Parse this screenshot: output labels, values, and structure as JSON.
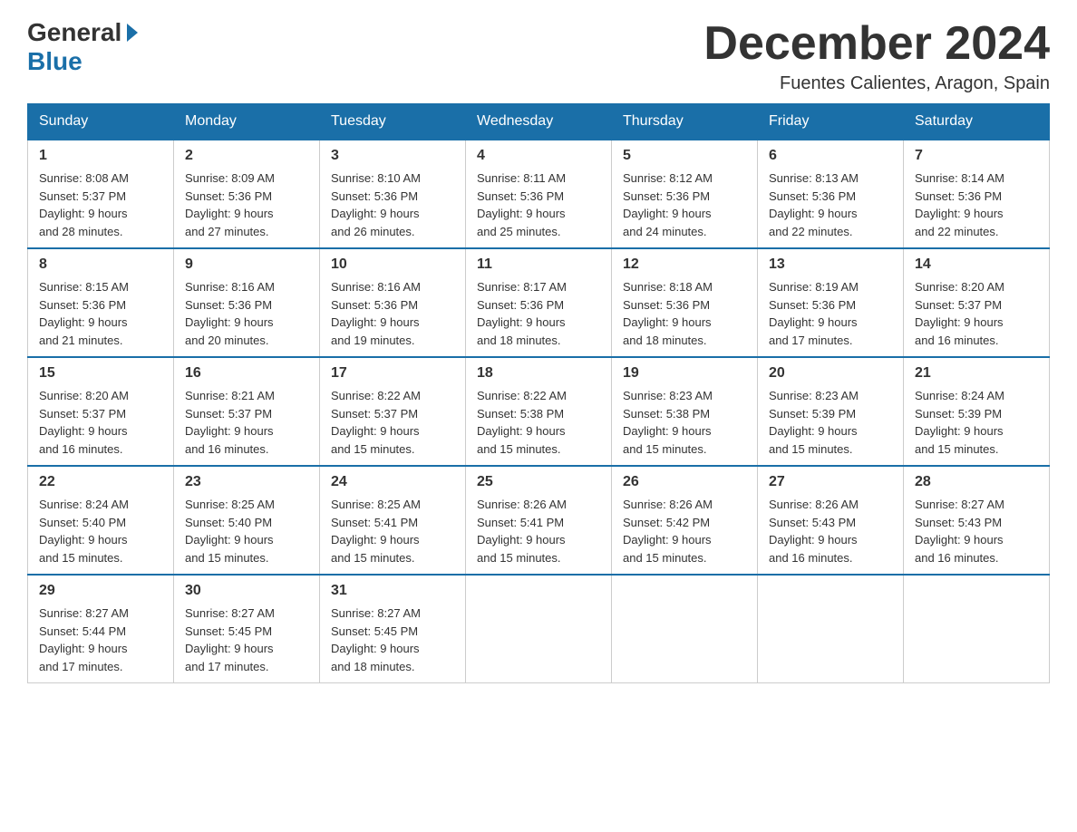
{
  "header": {
    "logo_general": "General",
    "logo_blue": "Blue",
    "month_title": "December 2024",
    "location": "Fuentes Calientes, Aragon, Spain"
  },
  "days_of_week": [
    "Sunday",
    "Monday",
    "Tuesday",
    "Wednesday",
    "Thursday",
    "Friday",
    "Saturday"
  ],
  "weeks": [
    [
      {
        "day": "1",
        "sunrise": "8:08 AM",
        "sunset": "5:37 PM",
        "daylight": "9 hours and 28 minutes."
      },
      {
        "day": "2",
        "sunrise": "8:09 AM",
        "sunset": "5:36 PM",
        "daylight": "9 hours and 27 minutes."
      },
      {
        "day": "3",
        "sunrise": "8:10 AM",
        "sunset": "5:36 PM",
        "daylight": "9 hours and 26 minutes."
      },
      {
        "day": "4",
        "sunrise": "8:11 AM",
        "sunset": "5:36 PM",
        "daylight": "9 hours and 25 minutes."
      },
      {
        "day": "5",
        "sunrise": "8:12 AM",
        "sunset": "5:36 PM",
        "daylight": "9 hours and 24 minutes."
      },
      {
        "day": "6",
        "sunrise": "8:13 AM",
        "sunset": "5:36 PM",
        "daylight": "9 hours and 22 minutes."
      },
      {
        "day": "7",
        "sunrise": "8:14 AM",
        "sunset": "5:36 PM",
        "daylight": "9 hours and 22 minutes."
      }
    ],
    [
      {
        "day": "8",
        "sunrise": "8:15 AM",
        "sunset": "5:36 PM",
        "daylight": "9 hours and 21 minutes."
      },
      {
        "day": "9",
        "sunrise": "8:16 AM",
        "sunset": "5:36 PM",
        "daylight": "9 hours and 20 minutes."
      },
      {
        "day": "10",
        "sunrise": "8:16 AM",
        "sunset": "5:36 PM",
        "daylight": "9 hours and 19 minutes."
      },
      {
        "day": "11",
        "sunrise": "8:17 AM",
        "sunset": "5:36 PM",
        "daylight": "9 hours and 18 minutes."
      },
      {
        "day": "12",
        "sunrise": "8:18 AM",
        "sunset": "5:36 PM",
        "daylight": "9 hours and 18 minutes."
      },
      {
        "day": "13",
        "sunrise": "8:19 AM",
        "sunset": "5:36 PM",
        "daylight": "9 hours and 17 minutes."
      },
      {
        "day": "14",
        "sunrise": "8:20 AM",
        "sunset": "5:37 PM",
        "daylight": "9 hours and 16 minutes."
      }
    ],
    [
      {
        "day": "15",
        "sunrise": "8:20 AM",
        "sunset": "5:37 PM",
        "daylight": "9 hours and 16 minutes."
      },
      {
        "day": "16",
        "sunrise": "8:21 AM",
        "sunset": "5:37 PM",
        "daylight": "9 hours and 16 minutes."
      },
      {
        "day": "17",
        "sunrise": "8:22 AM",
        "sunset": "5:37 PM",
        "daylight": "9 hours and 15 minutes."
      },
      {
        "day": "18",
        "sunrise": "8:22 AM",
        "sunset": "5:38 PM",
        "daylight": "9 hours and 15 minutes."
      },
      {
        "day": "19",
        "sunrise": "8:23 AM",
        "sunset": "5:38 PM",
        "daylight": "9 hours and 15 minutes."
      },
      {
        "day": "20",
        "sunrise": "8:23 AM",
        "sunset": "5:39 PM",
        "daylight": "9 hours and 15 minutes."
      },
      {
        "day": "21",
        "sunrise": "8:24 AM",
        "sunset": "5:39 PM",
        "daylight": "9 hours and 15 minutes."
      }
    ],
    [
      {
        "day": "22",
        "sunrise": "8:24 AM",
        "sunset": "5:40 PM",
        "daylight": "9 hours and 15 minutes."
      },
      {
        "day": "23",
        "sunrise": "8:25 AM",
        "sunset": "5:40 PM",
        "daylight": "9 hours and 15 minutes."
      },
      {
        "day": "24",
        "sunrise": "8:25 AM",
        "sunset": "5:41 PM",
        "daylight": "9 hours and 15 minutes."
      },
      {
        "day": "25",
        "sunrise": "8:26 AM",
        "sunset": "5:41 PM",
        "daylight": "9 hours and 15 minutes."
      },
      {
        "day": "26",
        "sunrise": "8:26 AM",
        "sunset": "5:42 PM",
        "daylight": "9 hours and 15 minutes."
      },
      {
        "day": "27",
        "sunrise": "8:26 AM",
        "sunset": "5:43 PM",
        "daylight": "9 hours and 16 minutes."
      },
      {
        "day": "28",
        "sunrise": "8:27 AM",
        "sunset": "5:43 PM",
        "daylight": "9 hours and 16 minutes."
      }
    ],
    [
      {
        "day": "29",
        "sunrise": "8:27 AM",
        "sunset": "5:44 PM",
        "daylight": "9 hours and 17 minutes."
      },
      {
        "day": "30",
        "sunrise": "8:27 AM",
        "sunset": "5:45 PM",
        "daylight": "9 hours and 17 minutes."
      },
      {
        "day": "31",
        "sunrise": "8:27 AM",
        "sunset": "5:45 PM",
        "daylight": "9 hours and 18 minutes."
      },
      null,
      null,
      null,
      null
    ]
  ],
  "labels": {
    "sunrise": "Sunrise:",
    "sunset": "Sunset:",
    "daylight": "Daylight:"
  }
}
